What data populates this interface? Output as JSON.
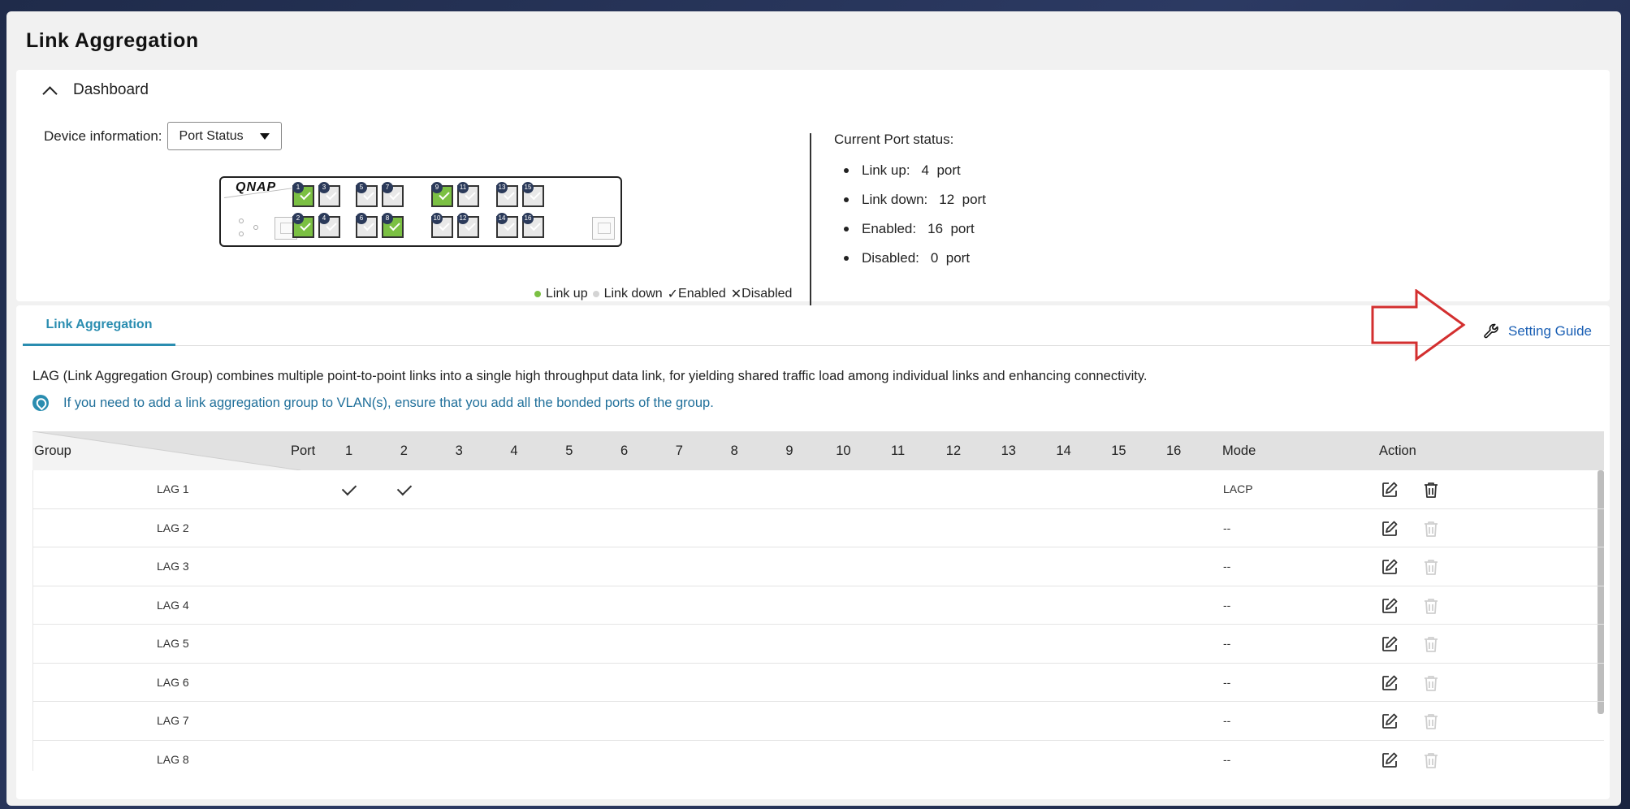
{
  "page_title": "Link Aggregation",
  "dashboard": {
    "title": "Dashboard",
    "device_label": "Device information:",
    "device_select": "Port Status",
    "switch_logo": "QNAP",
    "ports_top": [
      {
        "n": "1",
        "up": true
      },
      {
        "n": "3",
        "up": false
      },
      {
        "n": "5",
        "up": false
      },
      {
        "n": "7",
        "up": false
      },
      {
        "n": "9",
        "up": true
      },
      {
        "n": "11",
        "up": false
      },
      {
        "n": "13",
        "up": false
      },
      {
        "n": "15",
        "up": false
      }
    ],
    "ports_bottom": [
      {
        "n": "2",
        "up": true
      },
      {
        "n": "4",
        "up": false
      },
      {
        "n": "6",
        "up": false
      },
      {
        "n": "8",
        "up": true
      },
      {
        "n": "10",
        "up": false
      },
      {
        "n": "12",
        "up": false
      },
      {
        "n": "14",
        "up": false
      },
      {
        "n": "16",
        "up": false
      }
    ],
    "legend": {
      "link_up": "Link up",
      "link_down": "Link down",
      "enabled": "Enabled",
      "disabled": "Disabled",
      "link_up_color": "#7bc043",
      "link_down_color": "#d4d4d4"
    },
    "port_status": {
      "title": "Current Port status:",
      "items": [
        {
          "label": "Link up:",
          "value": "4  port"
        },
        {
          "label": "Link down:",
          "value": "12  port"
        },
        {
          "label": "Enabled:",
          "value": "16  port"
        },
        {
          "label": "Disabled:",
          "value": "0  port"
        }
      ]
    }
  },
  "tab": "Link Aggregation",
  "setting_guide": "Setting Guide",
  "description": "LAG (Link Aggregation Group) combines multiple point-to-point links into a single high throughput data link, for yielding shared traffic load among individual links and enhancing connectivity.",
  "note": "If you need to add a link aggregation group to VLAN(s), ensure that you add all the bonded ports of the group.",
  "table": {
    "group_header": "Group",
    "port_header": "Port",
    "port_columns": [
      "1",
      "2",
      "3",
      "4",
      "5",
      "6",
      "7",
      "8",
      "9",
      "10",
      "11",
      "12",
      "13",
      "14",
      "15",
      "16"
    ],
    "mode_header": "Mode",
    "action_header": "Action",
    "rows": [
      {
        "group": "LAG  1",
        "ports": [
          "1",
          "2"
        ],
        "mode": "LACP",
        "deletable": true
      },
      {
        "group": "LAG  2",
        "ports": [],
        "mode": "--",
        "deletable": false
      },
      {
        "group": "LAG  3",
        "ports": [],
        "mode": "--",
        "deletable": false
      },
      {
        "group": "LAG  4",
        "ports": [],
        "mode": "--",
        "deletable": false
      },
      {
        "group": "LAG  5",
        "ports": [],
        "mode": "--",
        "deletable": false
      },
      {
        "group": "LAG  6",
        "ports": [],
        "mode": "--",
        "deletable": false
      },
      {
        "group": "LAG  7",
        "ports": [],
        "mode": "--",
        "deletable": false
      },
      {
        "group": "LAG  8",
        "ports": [],
        "mode": "--",
        "deletable": false
      }
    ]
  },
  "colors": {
    "accent": "#2a8db0",
    "link": "#1a5fb4",
    "arrow": "#d32f2f"
  }
}
